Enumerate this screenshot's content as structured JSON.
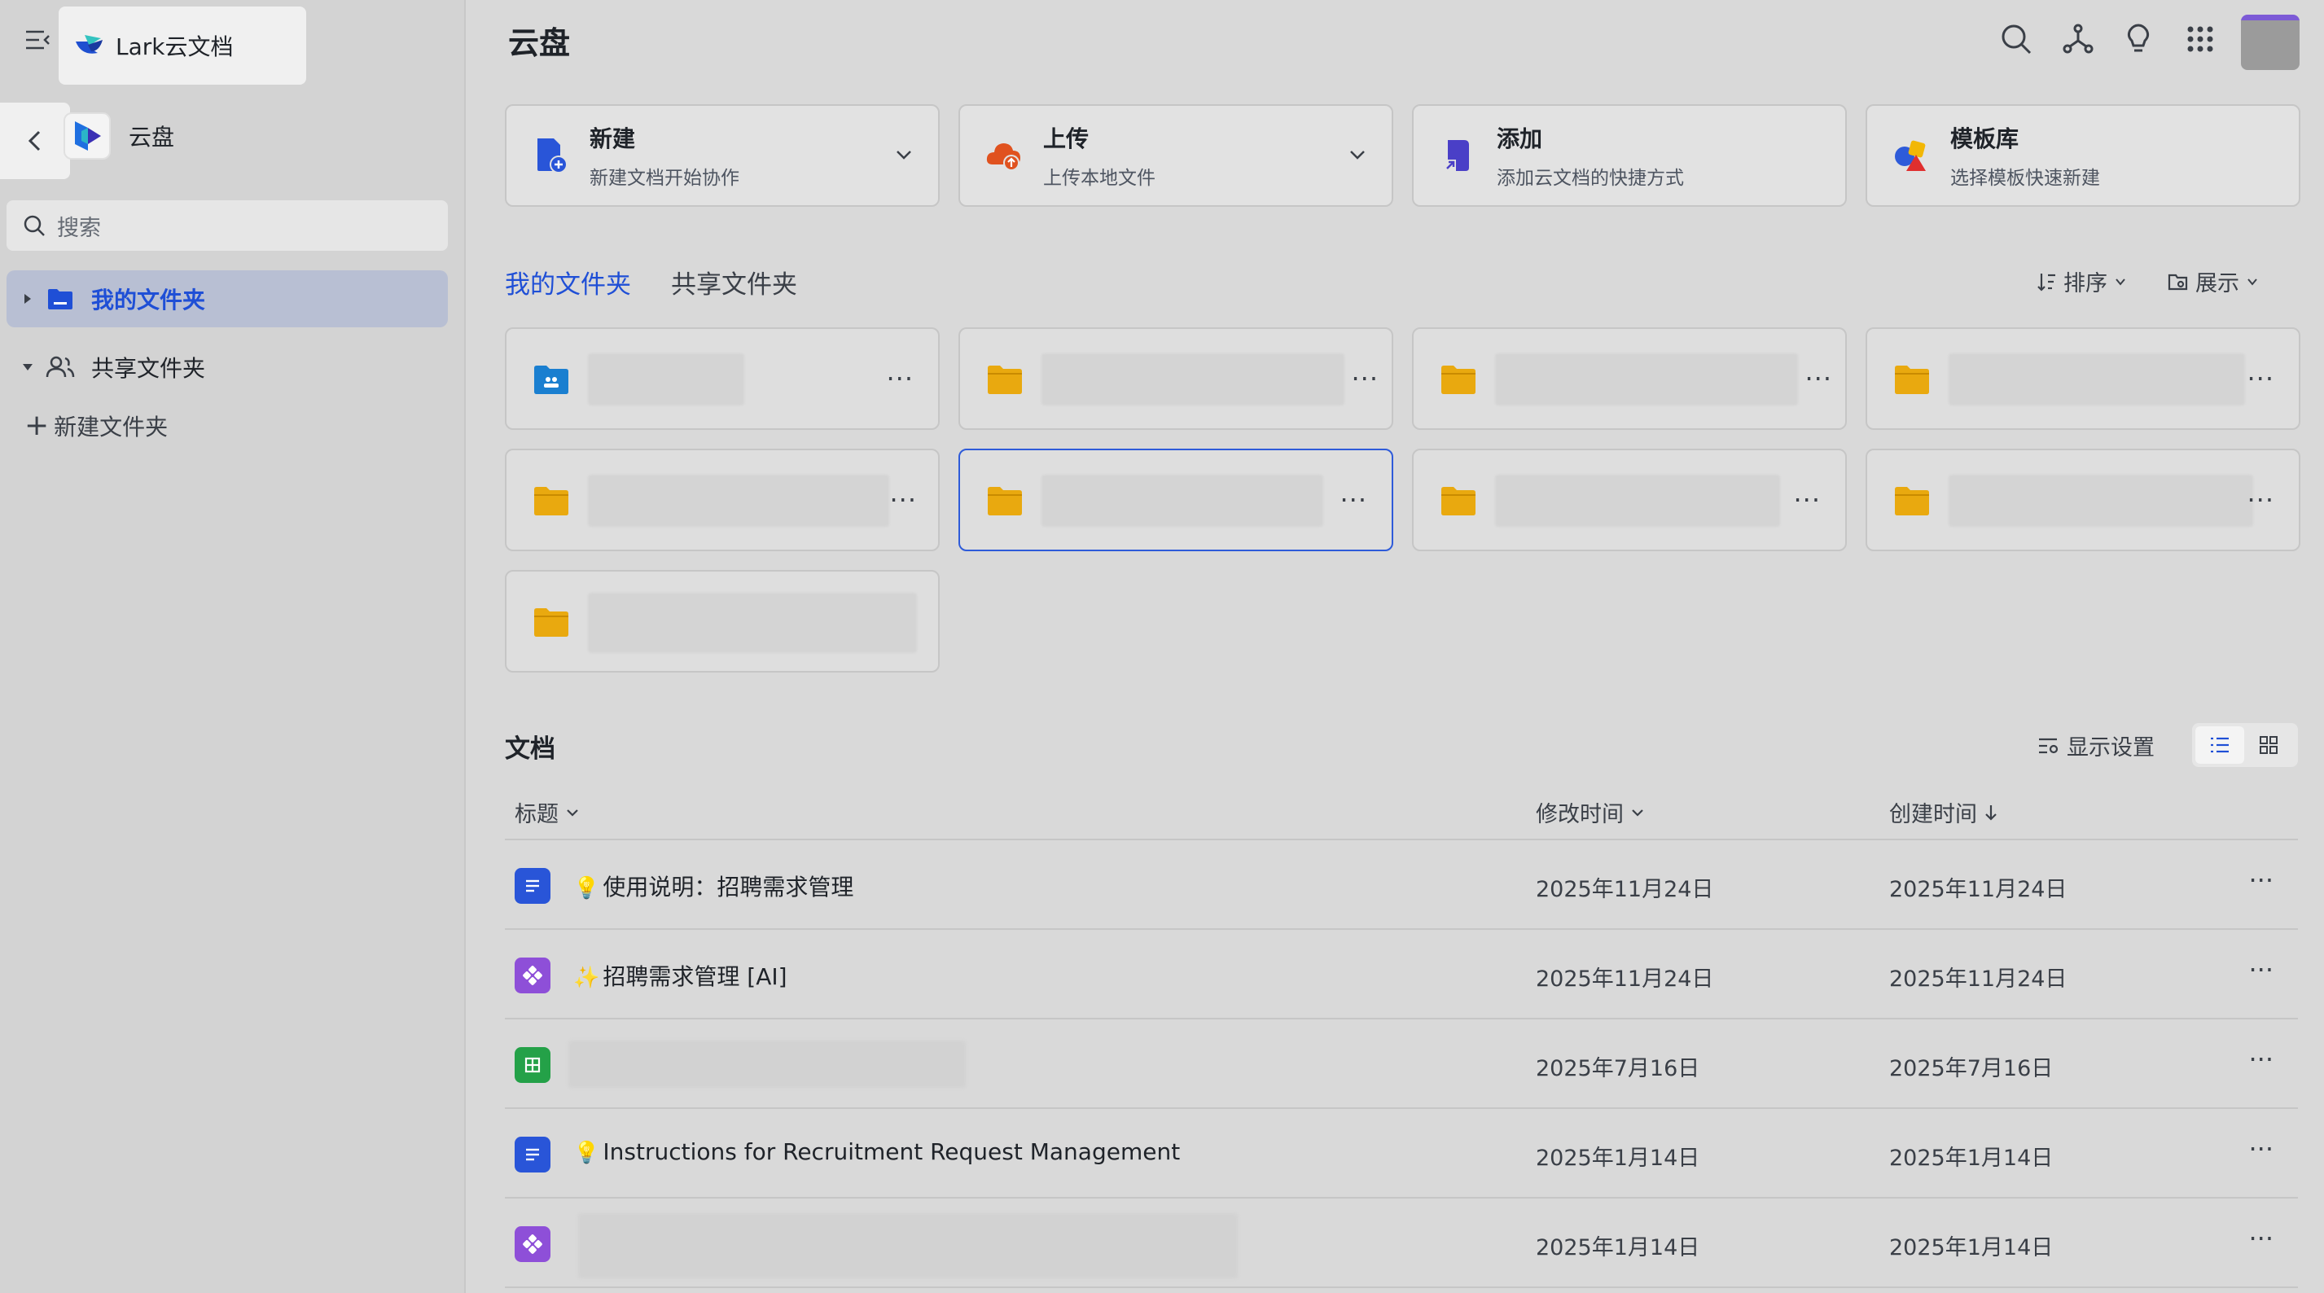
{
  "app": {
    "brand": "Lark云文档",
    "space_title": "云盘"
  },
  "sidebar": {
    "search_placeholder": "搜索",
    "items": [
      {
        "label": "我的文件夹",
        "active": true
      },
      {
        "label": "共享文件夹",
        "active": false
      }
    ],
    "new_folder_label": "新建文件夹"
  },
  "header": {
    "title": "云盘",
    "icons": [
      "search-icon",
      "graph-icon",
      "lightbulb-icon",
      "apps-grid-icon"
    ]
  },
  "actions": [
    {
      "title": "新建",
      "subtitle": "新建文档开始协作",
      "icon": "new-doc-icon",
      "has_dropdown": true
    },
    {
      "title": "上传",
      "subtitle": "上传本地文件",
      "icon": "upload-cloud-icon",
      "has_dropdown": true
    },
    {
      "title": "添加",
      "subtitle": "添加云文档的快捷方式",
      "icon": "shortcut-icon",
      "has_dropdown": false
    },
    {
      "title": "模板库",
      "subtitle": "选择模板快速新建",
      "icon": "template-icon",
      "has_dropdown": false
    }
  ],
  "folders": {
    "tabs": [
      "我的文件夹",
      "共享文件夹"
    ],
    "sort_label": "排序",
    "display_label": "展示",
    "more_label": "···"
  },
  "documents": {
    "title": "文档",
    "view_settings_label": "显示设置",
    "columns": {
      "title": "标题",
      "modified": "修改时间",
      "created": "创建时间"
    },
    "rows": [
      {
        "icon": "doc-icon",
        "emoji": "💡",
        "name": "使用说明：招聘需求管理",
        "modified": "2025年11月24日",
        "created": "2025年11月24日"
      },
      {
        "icon": "base-icon",
        "emoji": "✨",
        "name": "招聘需求管理 [AI]",
        "modified": "2025年11月24日",
        "created": "2025年11月24日"
      },
      {
        "icon": "sheet-icon",
        "emoji": "",
        "name": "",
        "modified": "2025年7月16日",
        "created": "2025年7月16日"
      },
      {
        "icon": "doc-icon",
        "emoji": "💡",
        "name": "Instructions for Recruitment Request Management",
        "modified": "2025年1月14日",
        "created": "2025年1月14日"
      },
      {
        "icon": "base-icon",
        "emoji": "",
        "name": "",
        "modified": "2025年1月14日",
        "created": "2025年1月14日"
      }
    ],
    "more_label": "···"
  },
  "colors": {
    "accent": "#1f4fd6",
    "folder": "#e9a90f",
    "selected_border": "#2e5bd9"
  }
}
